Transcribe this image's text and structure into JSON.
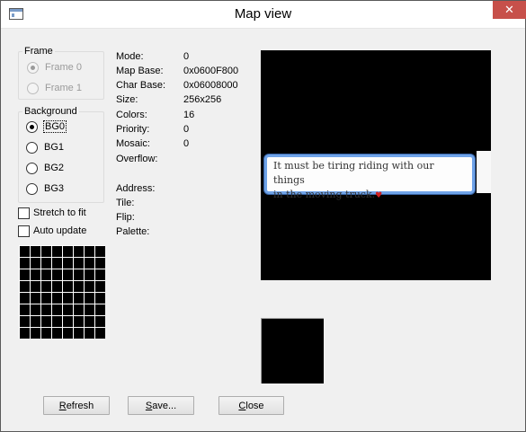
{
  "window": {
    "title": "Map view",
    "close_glyph": "✕"
  },
  "frame": {
    "legend": "Frame",
    "options": [
      {
        "label": "Frame 0",
        "checked": true,
        "enabled": false
      },
      {
        "label": "Frame 1",
        "checked": false,
        "enabled": false
      }
    ]
  },
  "background": {
    "legend": "Background",
    "options": [
      {
        "label": "BG0",
        "checked": true
      },
      {
        "label": "BG1",
        "checked": false
      },
      {
        "label": "BG2",
        "checked": false
      },
      {
        "label": "BG3",
        "checked": false
      }
    ]
  },
  "checkboxes": {
    "stretch": {
      "label": "Stretch to fit",
      "checked": false
    },
    "auto_update": {
      "label": "Auto update",
      "checked": false
    }
  },
  "info": {
    "rows": [
      {
        "label": "Mode:",
        "value": "0"
      },
      {
        "label": "Map Base:",
        "value": "0x0600F800"
      },
      {
        "label": "Char Base:",
        "value": "0x06008000"
      },
      {
        "label": "Size:",
        "value": "256x256"
      },
      {
        "label": "Colors:",
        "value": "16"
      },
      {
        "label": "Priority:",
        "value": "0"
      },
      {
        "label": "Mosaic:",
        "value": "0"
      },
      {
        "label": "Overflow:",
        "value": ""
      }
    ],
    "tile_rows": [
      {
        "label": "Address:",
        "value": ""
      },
      {
        "label": "Tile:",
        "value": ""
      },
      {
        "label": "Flip:",
        "value": ""
      },
      {
        "label": "Palette:",
        "value": ""
      }
    ]
  },
  "map": {
    "dialog_line1": "It must be tiring riding with our things",
    "dialog_line2": "in the moving truck.",
    "dialog_end_glyph": "♥"
  },
  "buttons": {
    "refresh": {
      "mnemonic": "R",
      "rest": "efresh"
    },
    "save": {
      "mnemonic": "S",
      "rest": "ave..."
    },
    "close": {
      "mnemonic": "C",
      "rest": "lose"
    }
  },
  "colors": {
    "accent": "#6fa3e8",
    "close_button": "#c7504a"
  }
}
